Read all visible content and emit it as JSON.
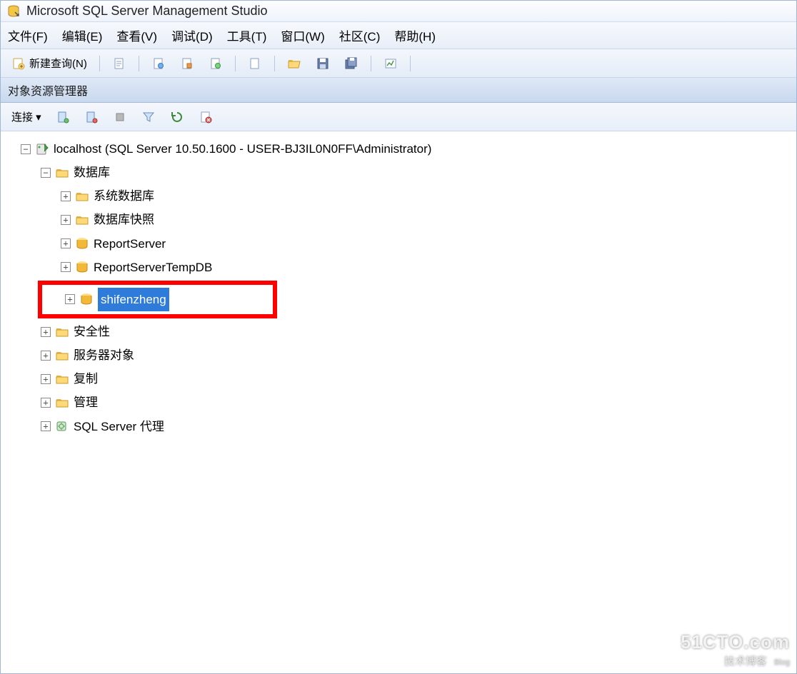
{
  "title": "Microsoft SQL Server Management Studio",
  "menu": {
    "file": "文件(F)",
    "edit": "编辑(E)",
    "view": "查看(V)",
    "debug": "调试(D)",
    "tools": "工具(T)",
    "window": "窗口(W)",
    "community": "社区(C)",
    "help": "帮助(H)"
  },
  "toolbar": {
    "new_query": "新建查询(N)"
  },
  "panel": {
    "title": "对象资源管理器",
    "connect": "连接 ▾"
  },
  "tree": {
    "server": "localhost (SQL Server 10.50.1600 - USER-BJ3IL0N0FF\\Administrator)",
    "databases": "数据库",
    "db_children": {
      "sys_db": "系统数据库",
      "snapshots": "数据库快照",
      "reportserver": "ReportServer",
      "reportserver_temp": "ReportServerTempDB",
      "shifenzheng": "shifenzheng"
    },
    "security": "安全性",
    "server_objects": "服务器对象",
    "replication": "复制",
    "management": "管理",
    "agent": "SQL Server 代理"
  },
  "watermark": {
    "line1": "51CTO.com",
    "line2": "技术博客",
    "line2_suffix": "Blog"
  }
}
